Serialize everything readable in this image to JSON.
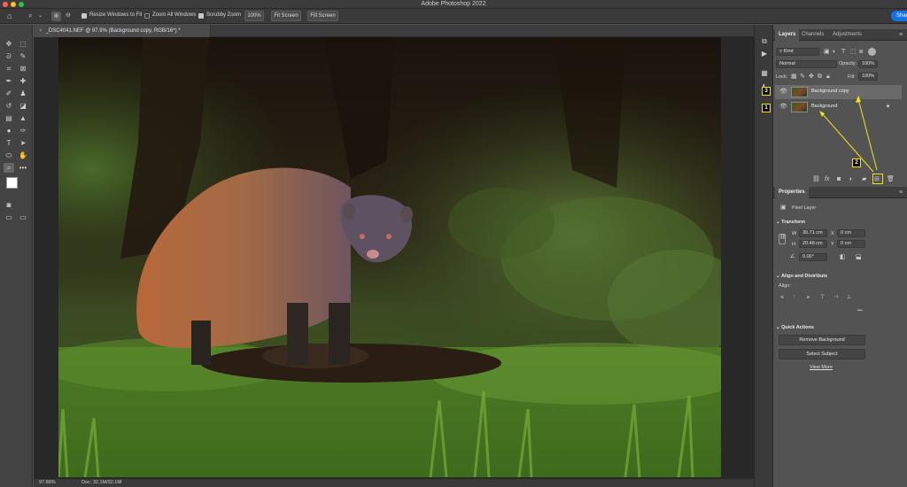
{
  "app": {
    "window_title": "Adobe Photoshop 2022",
    "share_label": "Share"
  },
  "options_bar": {
    "resize_windows_label": "Resize Windows to Fit",
    "resize_windows_checked": true,
    "zoom_all_windows_label": "Zoom All Windows",
    "zoom_all_windows_checked": false,
    "scrubby_zoom_label": "Scrubby Zoom",
    "scrubby_zoom_checked": true,
    "zoom_value": "100%",
    "fit_screen_label": "Fit Screen",
    "fill_screen_label": "Fill Screen"
  },
  "document": {
    "tab_title": "_DSC4041.NEF @ 97.9% (Background copy, RGB/16*) *",
    "status_zoom": "97.88%",
    "status_doc": "Doc: 32.1M/32.1M"
  },
  "layers_panel": {
    "tabs": [
      "Layers",
      "Channels",
      "Adjustments"
    ],
    "filter_kind": "Kind",
    "blend_mode": "Normal",
    "opacity_label": "Opacity:",
    "opacity_value": "100%",
    "lock_label": "Lock:",
    "fill_label": "Fill:",
    "fill_value": "100%",
    "layers": [
      {
        "name": "Background copy",
        "selected": true,
        "locked": false
      },
      {
        "name": "Background",
        "selected": false,
        "locked": true
      }
    ]
  },
  "properties_panel": {
    "title": "Properties",
    "pixel_layer_label": "Pixel Layer",
    "transform_label": "Transform",
    "w_label": "W",
    "w_value": "30.71 cm",
    "h_label": "H",
    "h_value": "20.48 cm",
    "x_label": "X",
    "x_value": "0 cm",
    "y_label": "Y",
    "y_value": "0 cm",
    "angle_value": "0.00°",
    "align_distribute_label": "Align and Distribute",
    "align_label": "Align:",
    "more_label": "•••",
    "quick_actions_label": "Quick Actions",
    "remove_background_label": "Remove Background",
    "select_subject_label": "Select Subject",
    "view_more_label": "View More"
  },
  "annotations": {
    "badge_1": "1",
    "badge_2": "2",
    "badge_3": "3",
    "color": "#f0e020"
  },
  "colors": {
    "accent": "#1473e6",
    "panel_bg": "#535353",
    "selected_layer": "#6a6a6a"
  }
}
